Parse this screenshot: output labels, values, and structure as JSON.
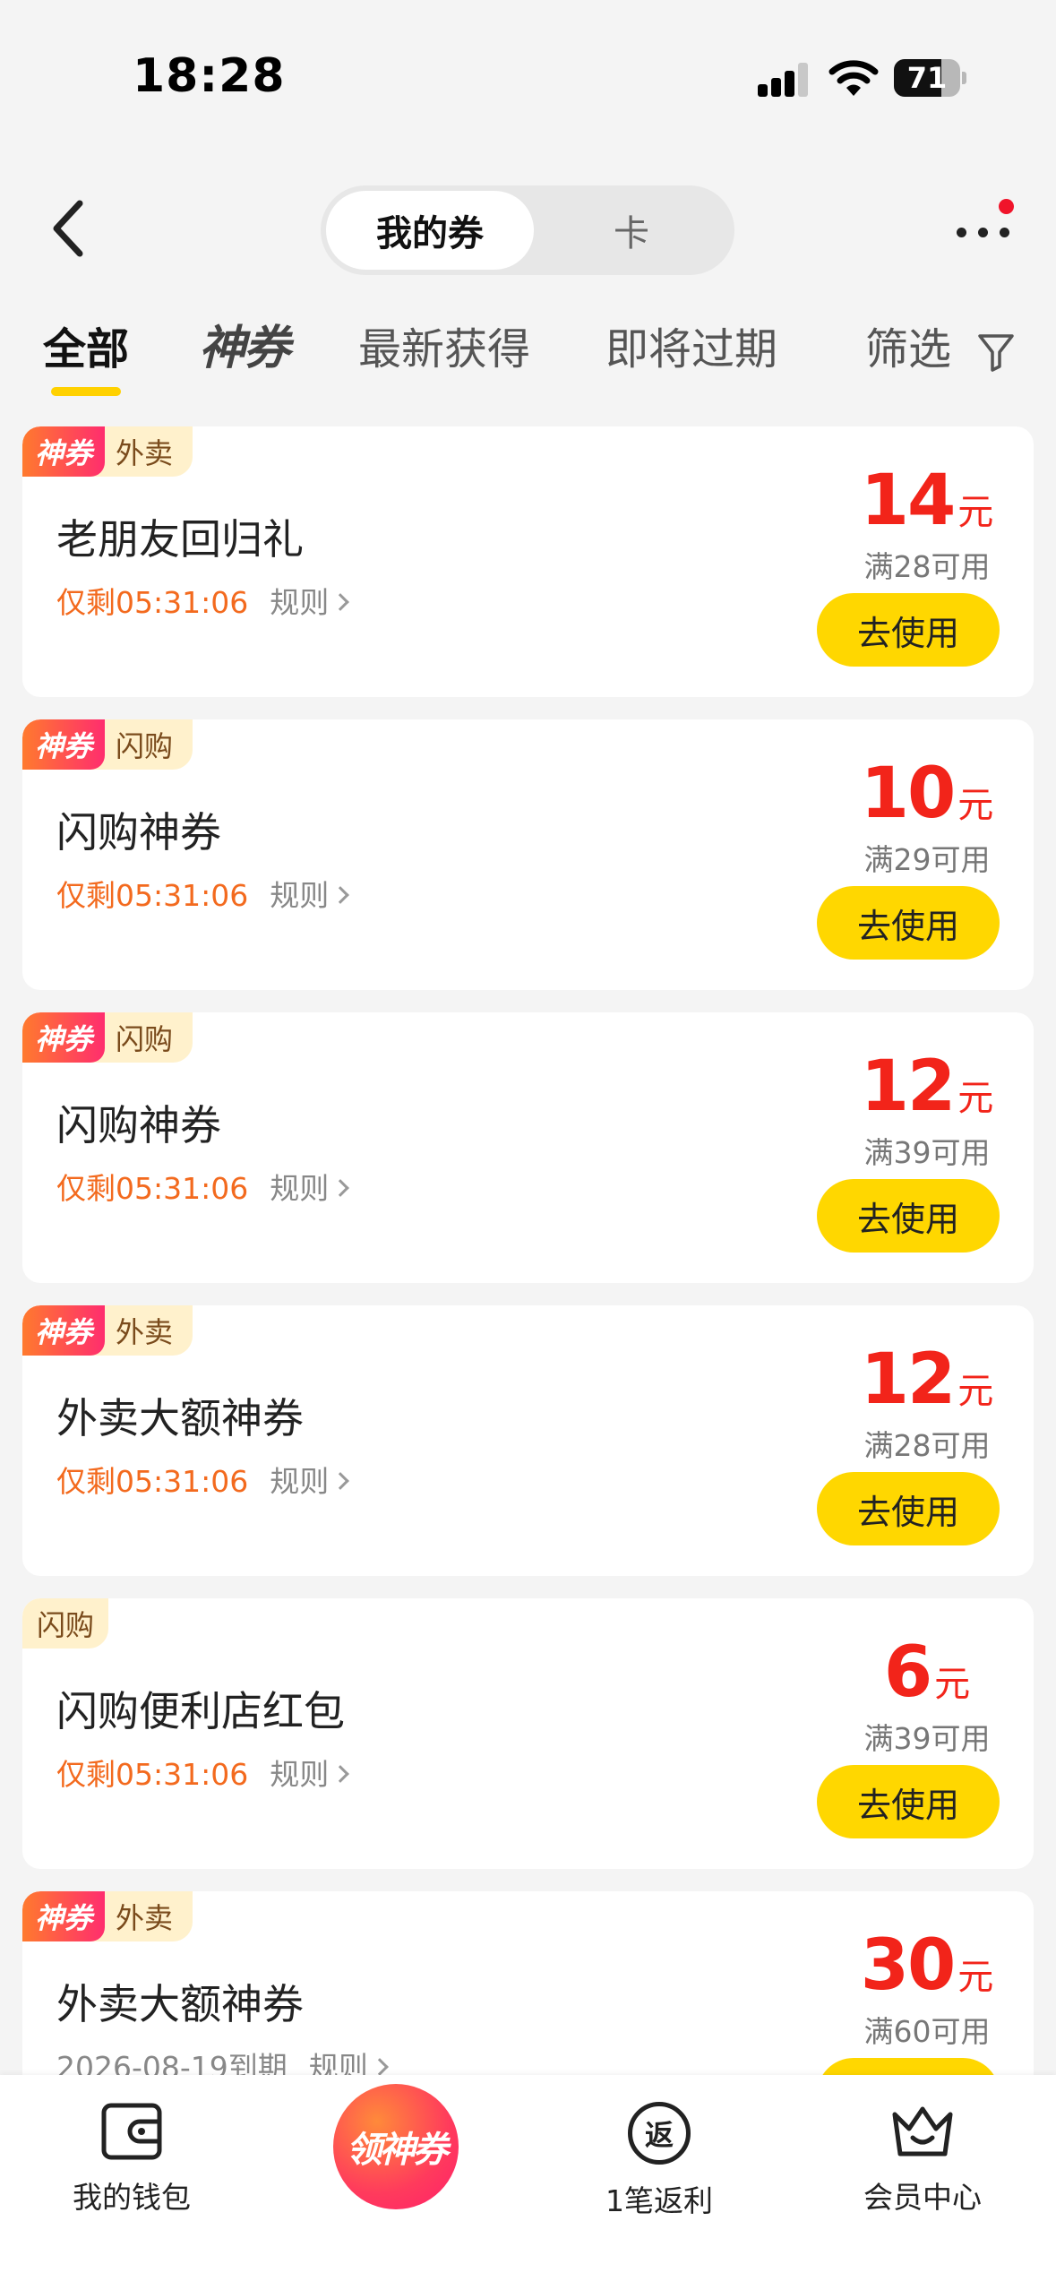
{
  "status_bar": {
    "time": "18:28",
    "battery": "71",
    "battery_level": 0.71
  },
  "header": {
    "seg_active": "我的券",
    "seg_inactive": "卡"
  },
  "tabs": {
    "all": "全部",
    "shen": "神券",
    "newest": "最新获得",
    "expiring": "即将过期",
    "filter": "筛选"
  },
  "coupons": [
    {
      "tag_shen": "神券",
      "tag_cat": "外卖",
      "title": "老朋友回归礼",
      "remain": "仅剩05:31:06",
      "rule": "规则",
      "price": "14",
      "unit": "元",
      "cond": "满28可用",
      "btn": "去使用"
    },
    {
      "tag_shen": "神券",
      "tag_cat": "闪购",
      "title": "闪购神券",
      "remain": "仅剩05:31:06",
      "rule": "规则",
      "price": "10",
      "unit": "元",
      "cond": "满29可用",
      "btn": "去使用"
    },
    {
      "tag_shen": "神券",
      "tag_cat": "闪购",
      "title": "闪购神券",
      "remain": "仅剩05:31:06",
      "rule": "规则",
      "price": "12",
      "unit": "元",
      "cond": "满39可用",
      "btn": "去使用"
    },
    {
      "tag_shen": "神券",
      "tag_cat": "外卖",
      "title": "外卖大额神券",
      "remain": "仅剩05:31:06",
      "rule": "规则",
      "price": "12",
      "unit": "元",
      "cond": "满28可用",
      "btn": "去使用"
    },
    {
      "tag_cat": "闪购",
      "title": "闪购便利店红包",
      "remain": "仅剩05:31:06",
      "rule": "规则",
      "price": "6",
      "unit": "元",
      "cond": "满39可用",
      "btn": "去使用"
    },
    {
      "tag_shen": "神券",
      "tag_cat": "外卖",
      "title": "外卖大额神券",
      "expire": "2026-08-19到期",
      "rule": "规则",
      "price": "30",
      "unit": "元",
      "cond": "满60可用",
      "btn": "去使用"
    }
  ],
  "bottom_nav": {
    "wallet": "我的钱包",
    "center": "领神券",
    "rebate_icon": "返",
    "rebate": "1笔返利",
    "member": "会员中心"
  },
  "colors": {
    "accent": "#ffd700",
    "price": "#f2241a",
    "remain": "#f36a1e"
  }
}
